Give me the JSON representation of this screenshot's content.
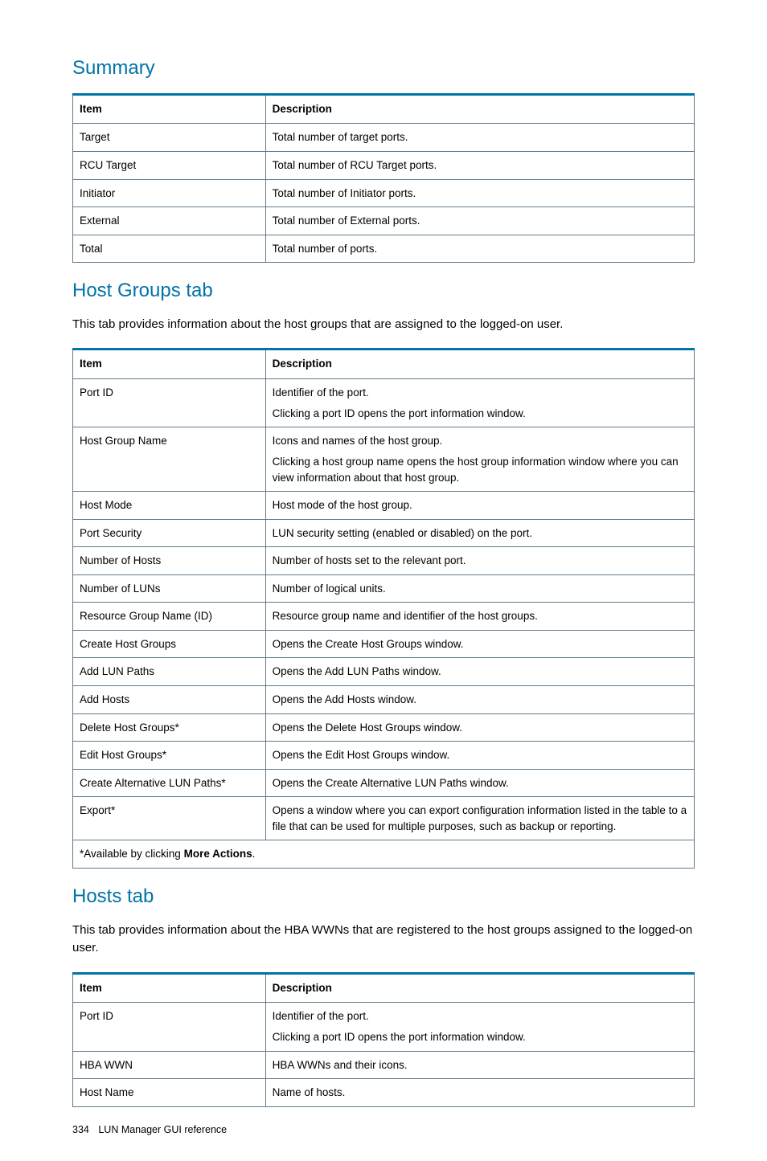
{
  "sections": {
    "summary": {
      "title": "Summary",
      "headers": {
        "item": "Item",
        "desc": "Description"
      },
      "rows": [
        {
          "item": "Target",
          "desc": "Total number of target ports."
        },
        {
          "item": "RCU Target",
          "desc": "Total number of RCU Target ports."
        },
        {
          "item": "Initiator",
          "desc": "Total number of Initiator ports."
        },
        {
          "item": "External",
          "desc": "Total number of External ports."
        },
        {
          "item": "Total",
          "desc": "Total number of ports."
        }
      ]
    },
    "hostgroups": {
      "title": "Host Groups tab",
      "intro": "This tab provides information about the host groups that are assigned to the logged-on user.",
      "headers": {
        "item": "Item",
        "desc": "Description"
      },
      "rows": [
        {
          "item": "Port ID",
          "desc1": "Identifier of the port.",
          "desc2": "Clicking a port ID opens the port information window."
        },
        {
          "item": "Host Group Name",
          "desc1": "Icons and names of the host group.",
          "desc2": "Clicking a host group name opens the host group information window where you can view information about that host group."
        },
        {
          "item": "Host Mode",
          "desc1": "Host mode of the host group."
        },
        {
          "item": "Port Security",
          "desc1": "LUN security setting (enabled or disabled) on the port."
        },
        {
          "item": "Number of Hosts",
          "desc1": "Number of hosts set to the relevant port."
        },
        {
          "item": "Number of LUNs",
          "desc1": "Number of logical units."
        },
        {
          "item": "Resource Group Name (ID)",
          "desc1": "Resource group name and identifier of the host groups."
        },
        {
          "item": "Create Host Groups",
          "desc1": "Opens the Create Host Groups window."
        },
        {
          "item": "Add LUN Paths",
          "desc1": "Opens the Add LUN Paths window."
        },
        {
          "item": "Add Hosts",
          "desc1": "Opens the Add Hosts window."
        },
        {
          "item": "Delete Host Groups*",
          "desc1": "Opens the Delete Host Groups window."
        },
        {
          "item": "Edit Host Groups*",
          "desc1": "Opens the Edit Host Groups window."
        },
        {
          "item": "Create Alternative LUN Paths*",
          "desc1": "Opens the Create Alternative LUN Paths window."
        },
        {
          "item": "Export*",
          "desc1": "Opens a window where you can export configuration information listed in the table to a file that can be used for multiple purposes, such as backup or reporting."
        }
      ],
      "footnote_prefix": "*Available by clicking ",
      "footnote_bold": "More Actions",
      "footnote_suffix": "."
    },
    "hosts": {
      "title": "Hosts tab",
      "intro": "This tab provides information about the HBA WWNs that are registered to the host groups assigned to the logged-on user.",
      "headers": {
        "item": "Item",
        "desc": "Description"
      },
      "rows": [
        {
          "item": "Port ID",
          "desc1": "Identifier of the port.",
          "desc2": "Clicking a port ID opens the port information window."
        },
        {
          "item": "HBA WWN",
          "desc1": "HBA WWNs and their icons."
        },
        {
          "item": "Host Name",
          "desc1": "Name of hosts."
        }
      ]
    }
  },
  "footer": {
    "page": "334",
    "title": "LUN Manager GUI reference"
  }
}
